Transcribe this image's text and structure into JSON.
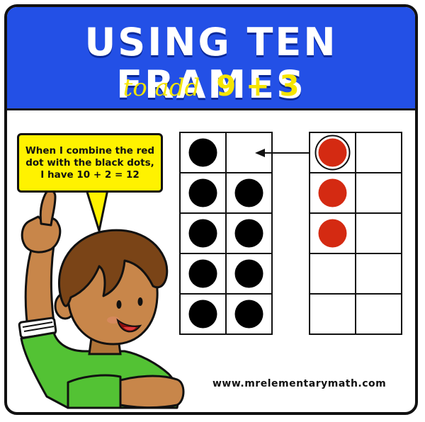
{
  "title": "USING TEN FRAMES",
  "subtitle": {
    "prefix": "to add",
    "equation": "9 + 3"
  },
  "speech_bubble": "When I combine the red dot with the black dots, I have 10 + 2 = 12",
  "website": "www.mrelementarymath.com",
  "left_frame": {
    "rows": 5,
    "cols": 2,
    "filled": 9,
    "dot_color": "#000000"
  },
  "right_frame": {
    "rows": 5,
    "cols": 2,
    "filled": 3,
    "dot_color": "#d42a12"
  },
  "colors": {
    "banner": "#2350e6",
    "title_text": "#ffffff",
    "subtitle_text": "#f5e500",
    "bubble": "#fff200",
    "shirt": "#53c234",
    "skin": "#c8864a",
    "hair": "#7a4417"
  },
  "illustration": {
    "character": "boy-raising-hand",
    "arrow": "left-arrow-from-red-dot"
  }
}
